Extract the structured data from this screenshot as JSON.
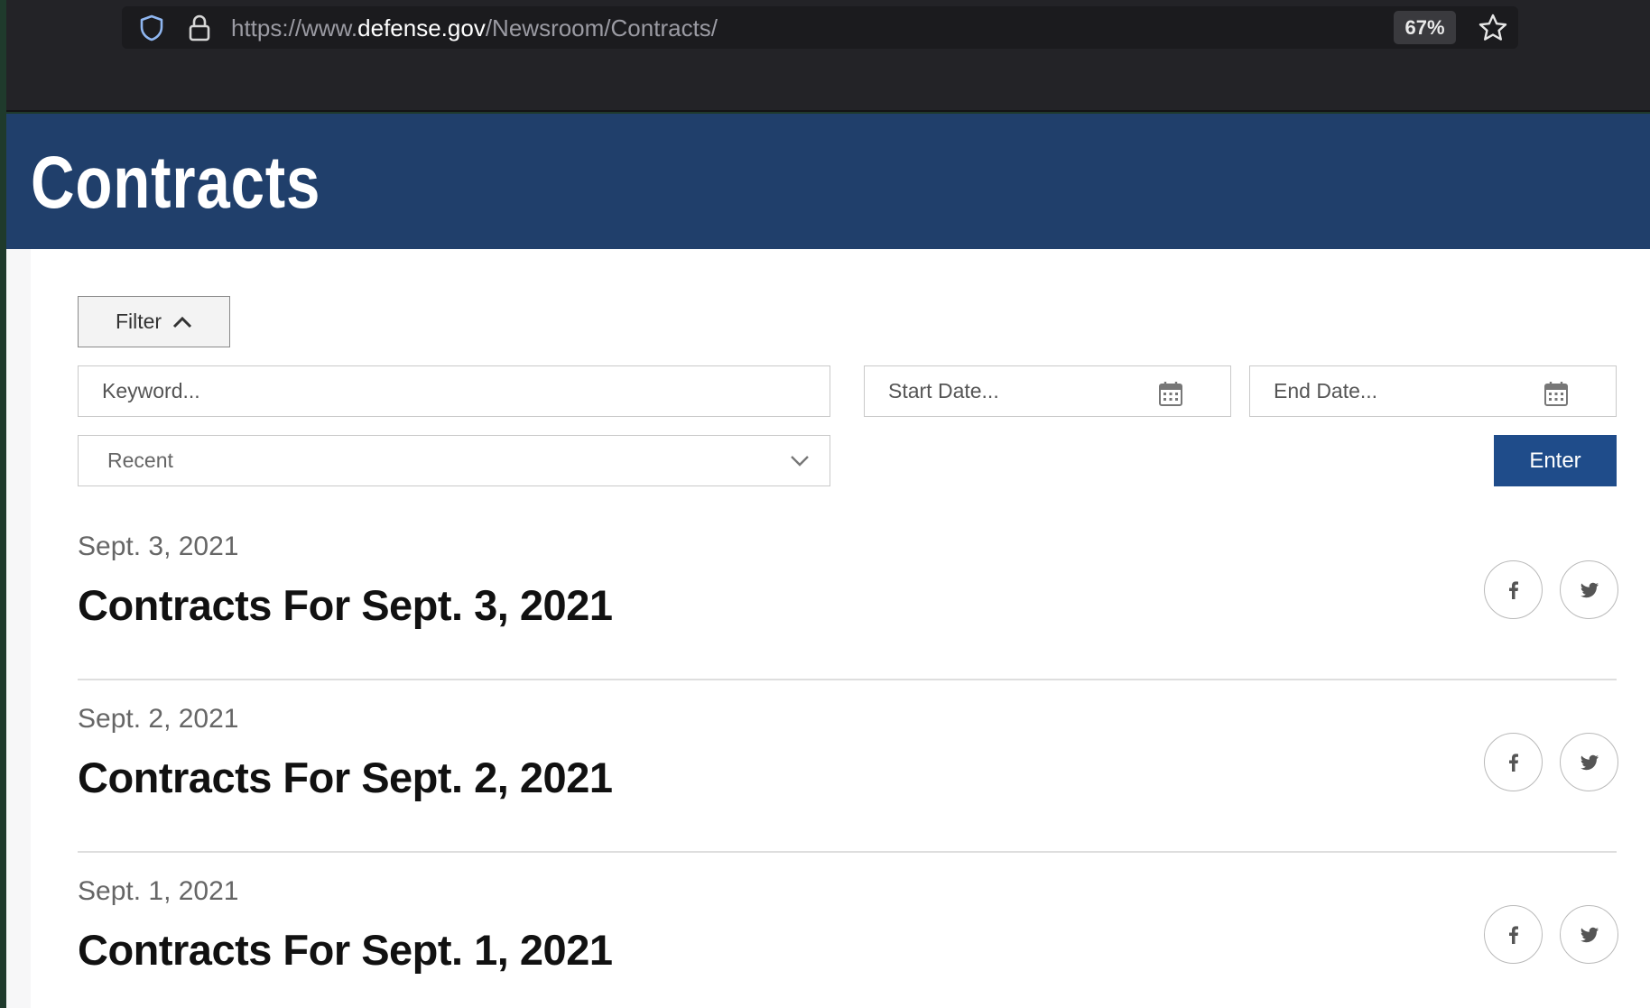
{
  "browser": {
    "url_prefix": "https://www.",
    "url_host": "defense.gov",
    "url_path": "/Newsroom/Contracts/",
    "zoom": "67%"
  },
  "page": {
    "title": "Contracts"
  },
  "filter": {
    "toggle_label": "Filter",
    "keyword_placeholder": "Keyword...",
    "start_date_placeholder": "Start Date...",
    "end_date_placeholder": "End Date...",
    "sort_selected": "Recent",
    "enter_label": "Enter"
  },
  "items": [
    {
      "date": "Sept. 3, 2021",
      "title": "Contracts For Sept. 3, 2021"
    },
    {
      "date": "Sept. 2, 2021",
      "title": "Contracts For Sept. 2, 2021"
    },
    {
      "date": "Sept. 1, 2021",
      "title": "Contracts For Sept. 1, 2021"
    }
  ],
  "icons": {
    "shield": "shield-icon",
    "lock": "lock-icon",
    "star": "star-icon",
    "calendar": "calendar-icon",
    "facebook": "facebook-icon",
    "twitter": "twitter-icon"
  },
  "colors": {
    "hero": "#203f6b",
    "enter_button": "#1f4c8a",
    "chrome": "#232327"
  }
}
